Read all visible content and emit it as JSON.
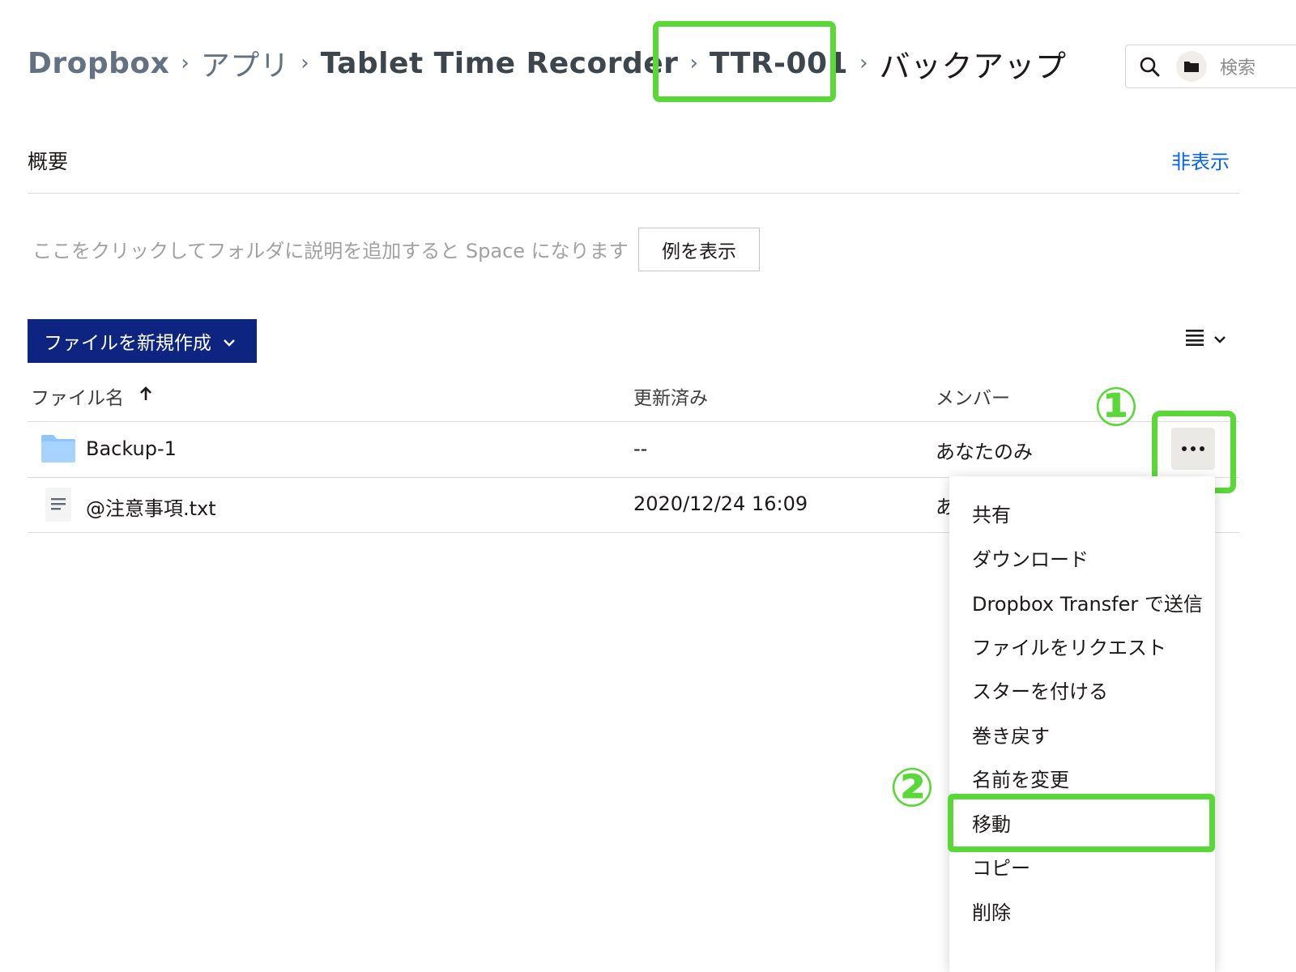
{
  "breadcrumb": {
    "items": [
      "Dropbox",
      "アプリ",
      "Tablet Time Recorder",
      "TTR-001"
    ],
    "current": "バックアップ"
  },
  "search": {
    "placeholder": "検索"
  },
  "overview": {
    "title": "概要",
    "hide_label": "非表示",
    "description_placeholder": "ここをクリックしてフォルダに説明を追加すると Space になります",
    "example_button": "例を表示"
  },
  "toolbar": {
    "new_file_label": "ファイルを新規作成"
  },
  "table": {
    "columns": {
      "name": "ファイル名",
      "modified": "更新済み",
      "members": "メンバー"
    },
    "rows": [
      {
        "name": "Backup-1",
        "modified": "--",
        "members": "あなたのみ",
        "icon": "folder-icon"
      },
      {
        "name": "@注意事項.txt",
        "modified": "2020/12/24 16:09",
        "members": "あ",
        "icon": "text-file-icon"
      }
    ]
  },
  "context_menu": {
    "items": [
      "共有",
      "ダウンロード",
      "Dropbox Transfer で送信",
      "ファイルをリクエスト",
      "スターを付ける",
      "巻き戻す",
      "名前を変更",
      "移動",
      "コピー",
      "削除"
    ]
  },
  "annotations": {
    "step1": "①",
    "step2": "②",
    "highlight_color": "#5ad838"
  },
  "colors": {
    "primary_button": "#0d2481",
    "link": "#0061fe",
    "folder": "#8ec5fc"
  }
}
